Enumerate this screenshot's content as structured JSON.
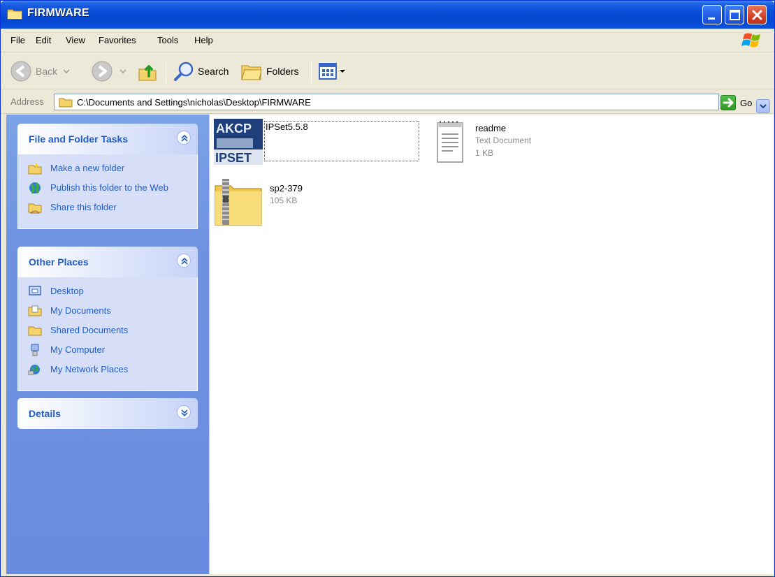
{
  "window": {
    "title": "FIRMWARE"
  },
  "menu": {
    "items": [
      "File",
      "Edit",
      "View",
      "Favorites",
      "Tools",
      "Help"
    ]
  },
  "toolbar": {
    "back_label": "Back",
    "search_label": "Search",
    "folders_label": "Folders"
  },
  "address": {
    "label": "Address",
    "value": "C:\\Documents and Settings\\nicholas\\Desktop\\FIRMWARE",
    "go_label": "Go"
  },
  "taskpane": {
    "file_tasks": {
      "title": "File and Folder Tasks",
      "items": [
        {
          "label": "Make a new folder",
          "icon": "new-folder-icon"
        },
        {
          "label": "Publish this folder to the Web",
          "icon": "globe-icon"
        },
        {
          "label": "Share this folder",
          "icon": "share-folder-icon"
        }
      ]
    },
    "other_places": {
      "title": "Other Places",
      "items": [
        {
          "label": "Desktop",
          "icon": "desktop-icon"
        },
        {
          "label": "My Documents",
          "icon": "my-documents-icon"
        },
        {
          "label": "Shared Documents",
          "icon": "shared-documents-icon"
        },
        {
          "label": "My Computer",
          "icon": "my-computer-icon"
        },
        {
          "label": "My Network Places",
          "icon": "network-places-icon"
        }
      ]
    },
    "details": {
      "title": "Details"
    }
  },
  "files": [
    {
      "name": "IPSet5.5.8",
      "type": "",
      "size": "",
      "icon": "ipset-app-icon",
      "icon_text_top": "AKCP",
      "icon_text_bottom": "IPSET"
    },
    {
      "name": "readme",
      "type": "Text Document",
      "size": "1 KB",
      "icon": "notepad-document-icon"
    },
    {
      "name": "sp2-379",
      "type": "",
      "size": "105 KB",
      "icon": "zip-folder-icon"
    }
  ],
  "colors": {
    "title_bar": "#0a4fd8",
    "task_pane": "#6f92e0",
    "panel_title": "#215dc6",
    "chrome": "#ece9d8"
  }
}
